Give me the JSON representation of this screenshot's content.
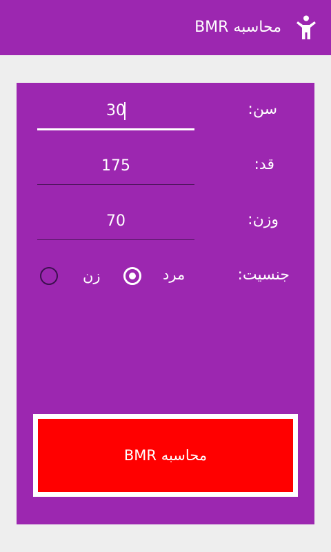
{
  "appbar": {
    "title": "محاسبه BMR",
    "icon": "person-icon"
  },
  "form": {
    "age": {
      "label": "سن:",
      "value": "30"
    },
    "height": {
      "label": "قد:",
      "value": "175"
    },
    "weight": {
      "label": "وزن:",
      "value": "70"
    },
    "gender": {
      "label": "جنسیت:",
      "options": [
        {
          "label": "مرد",
          "selected": true
        },
        {
          "label": "زن",
          "selected": false
        }
      ]
    }
  },
  "calculate_button": {
    "label": "محاسبه BMR"
  },
  "colors": {
    "primary": "#9c27b0",
    "background": "#eeeeee",
    "button": "#ff0000"
  }
}
